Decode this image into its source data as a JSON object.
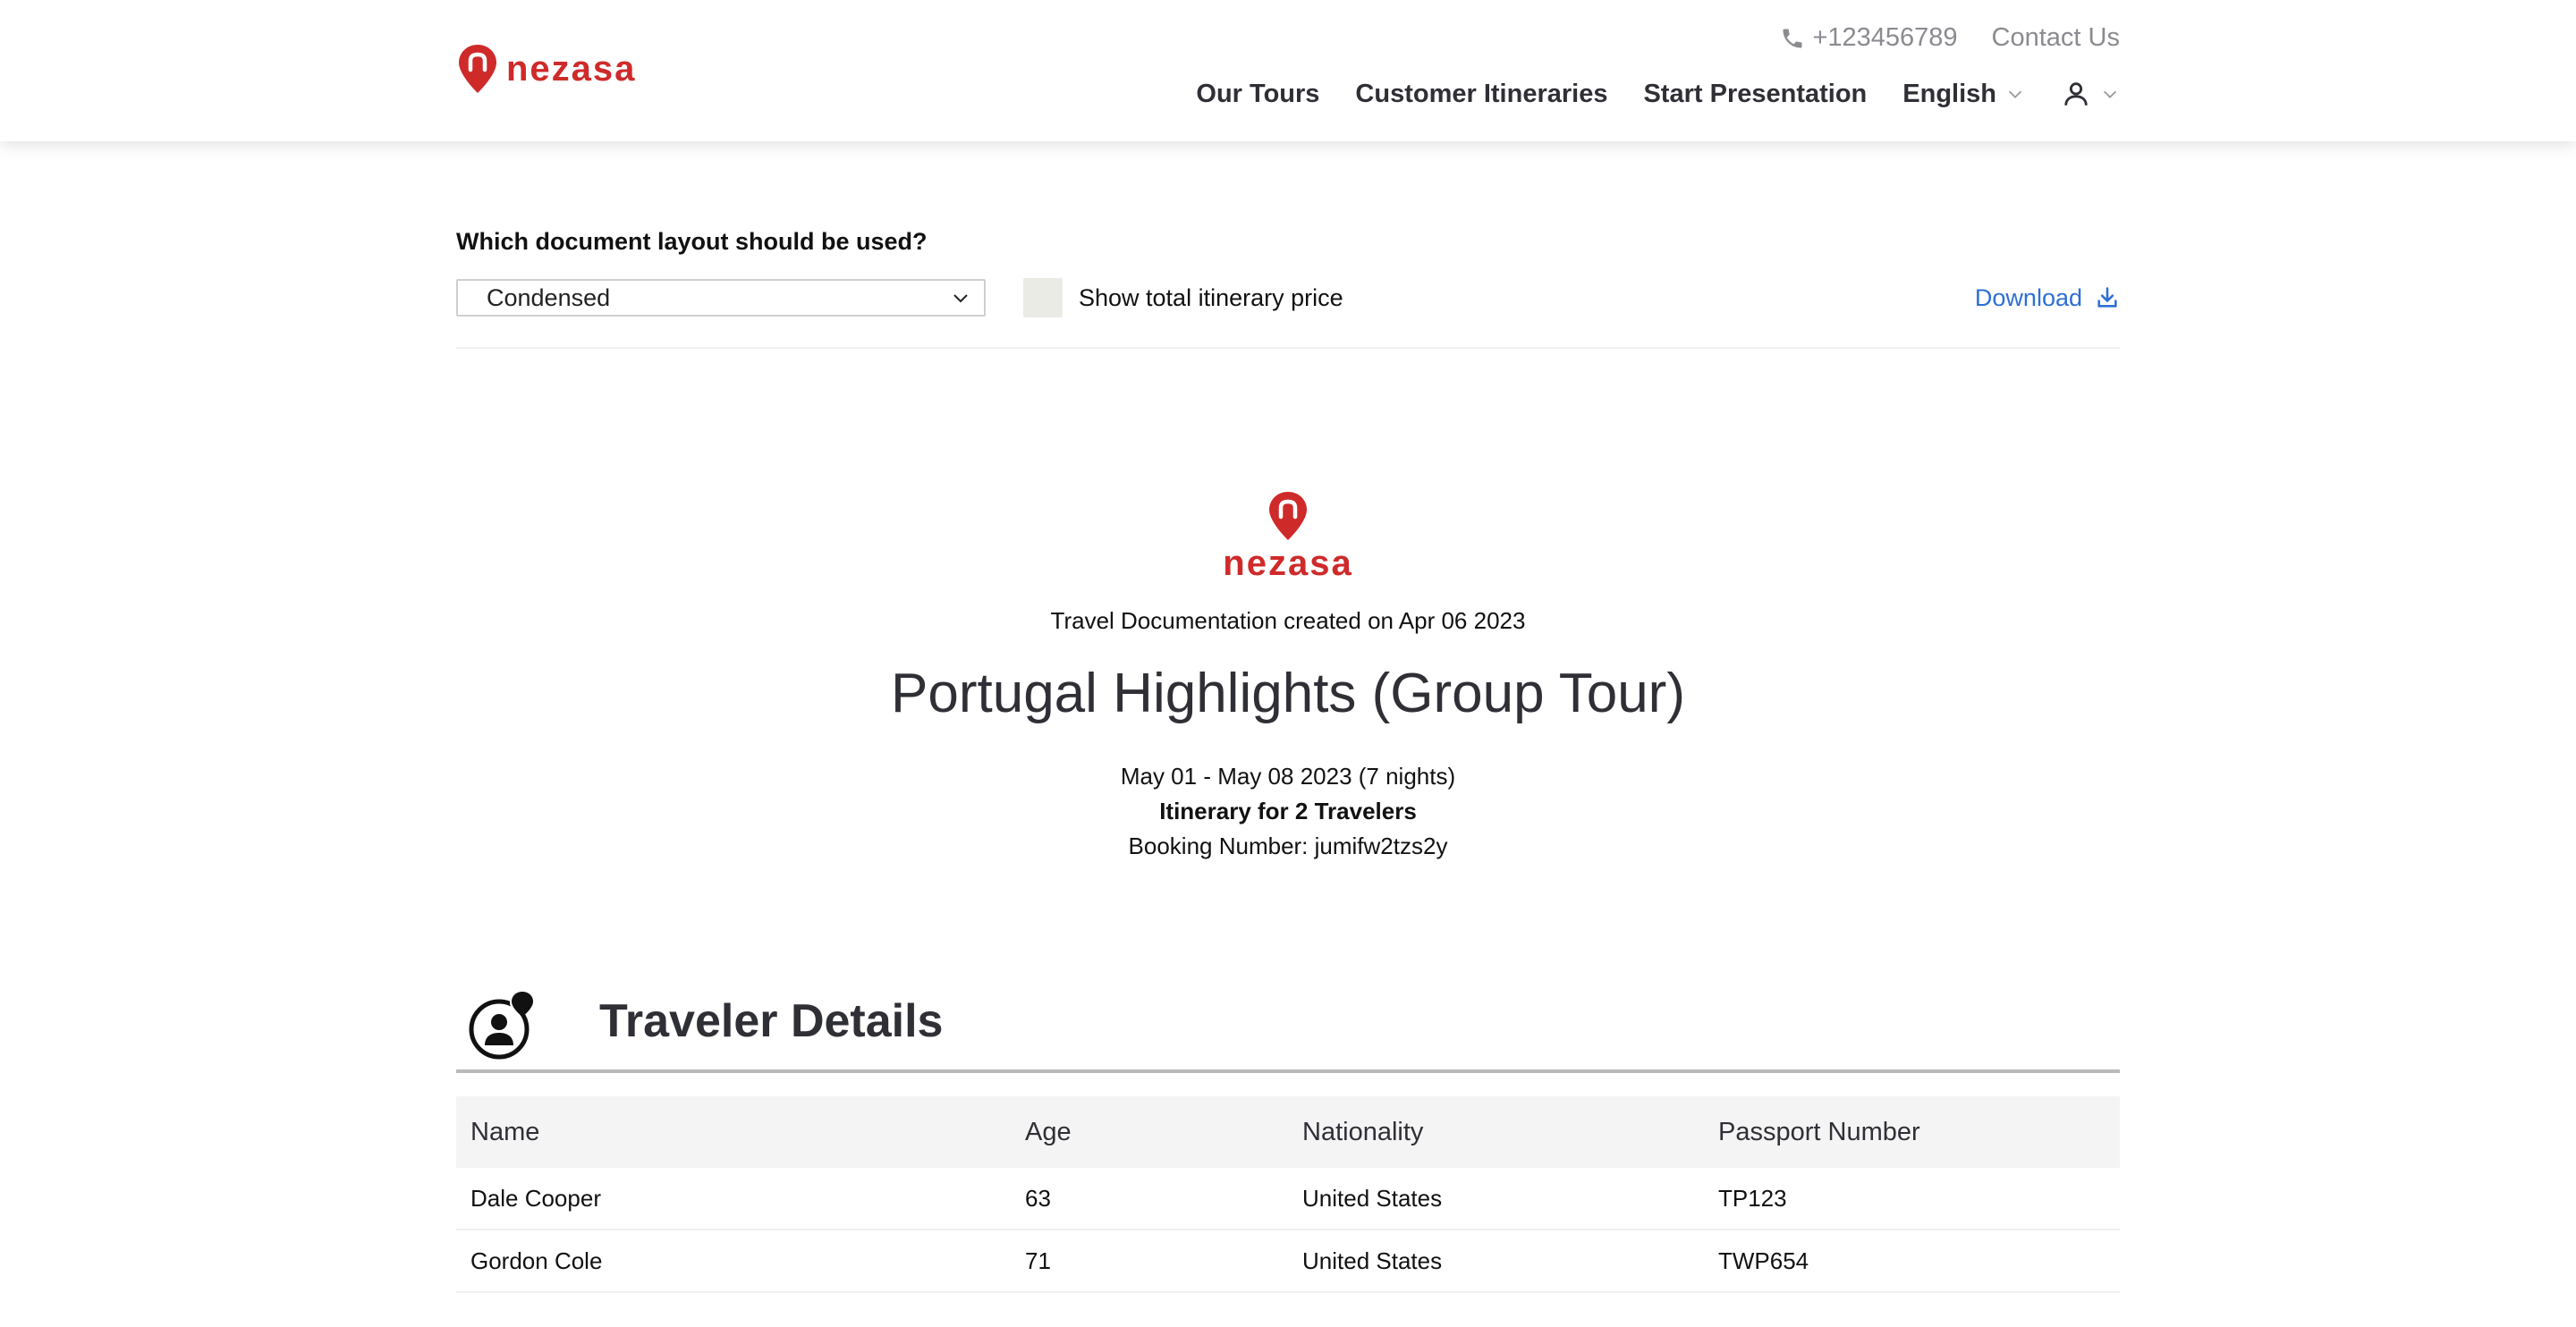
{
  "header": {
    "brand": "nezasa",
    "phone": "+123456789",
    "contact": "Contact Us",
    "nav": {
      "tours": "Our Tours",
      "itineraries": "Customer Itineraries",
      "presentation": "Start Presentation",
      "language": "English"
    }
  },
  "options": {
    "layout_question": "Which document layout should be used?",
    "layout_selected": "Condensed",
    "show_price_label": "Show total itinerary price",
    "show_price_checked": false,
    "download_label": "Download"
  },
  "document": {
    "brand": "nezasa",
    "created": "Travel Documentation created on Apr 06 2023",
    "title": "Portugal Highlights (Group Tour)",
    "dates": "May 01 - May 08 2023 (7 nights)",
    "travelers": "Itinerary for 2 Travelers",
    "booking": "Booking Number: jumifw2tzs2y"
  },
  "traveler_details": {
    "title": "Traveler Details",
    "columns": [
      "Name",
      "Age",
      "Nationality",
      "Passport Number"
    ],
    "rows": [
      [
        "Dale Cooper",
        "63",
        "United States",
        "TP123"
      ],
      [
        "Gordon Cole",
        "71",
        "United States",
        "TWP654"
      ]
    ]
  },
  "colors": {
    "brand_red": "#cf2a2a",
    "link_blue": "#2d6fd4",
    "text_dark": "#2f2f36"
  },
  "icons": [
    "phone-icon",
    "chevron-down-icon",
    "user-icon",
    "download-icon",
    "traveler-icon",
    "nezasa-pin-icon"
  ]
}
